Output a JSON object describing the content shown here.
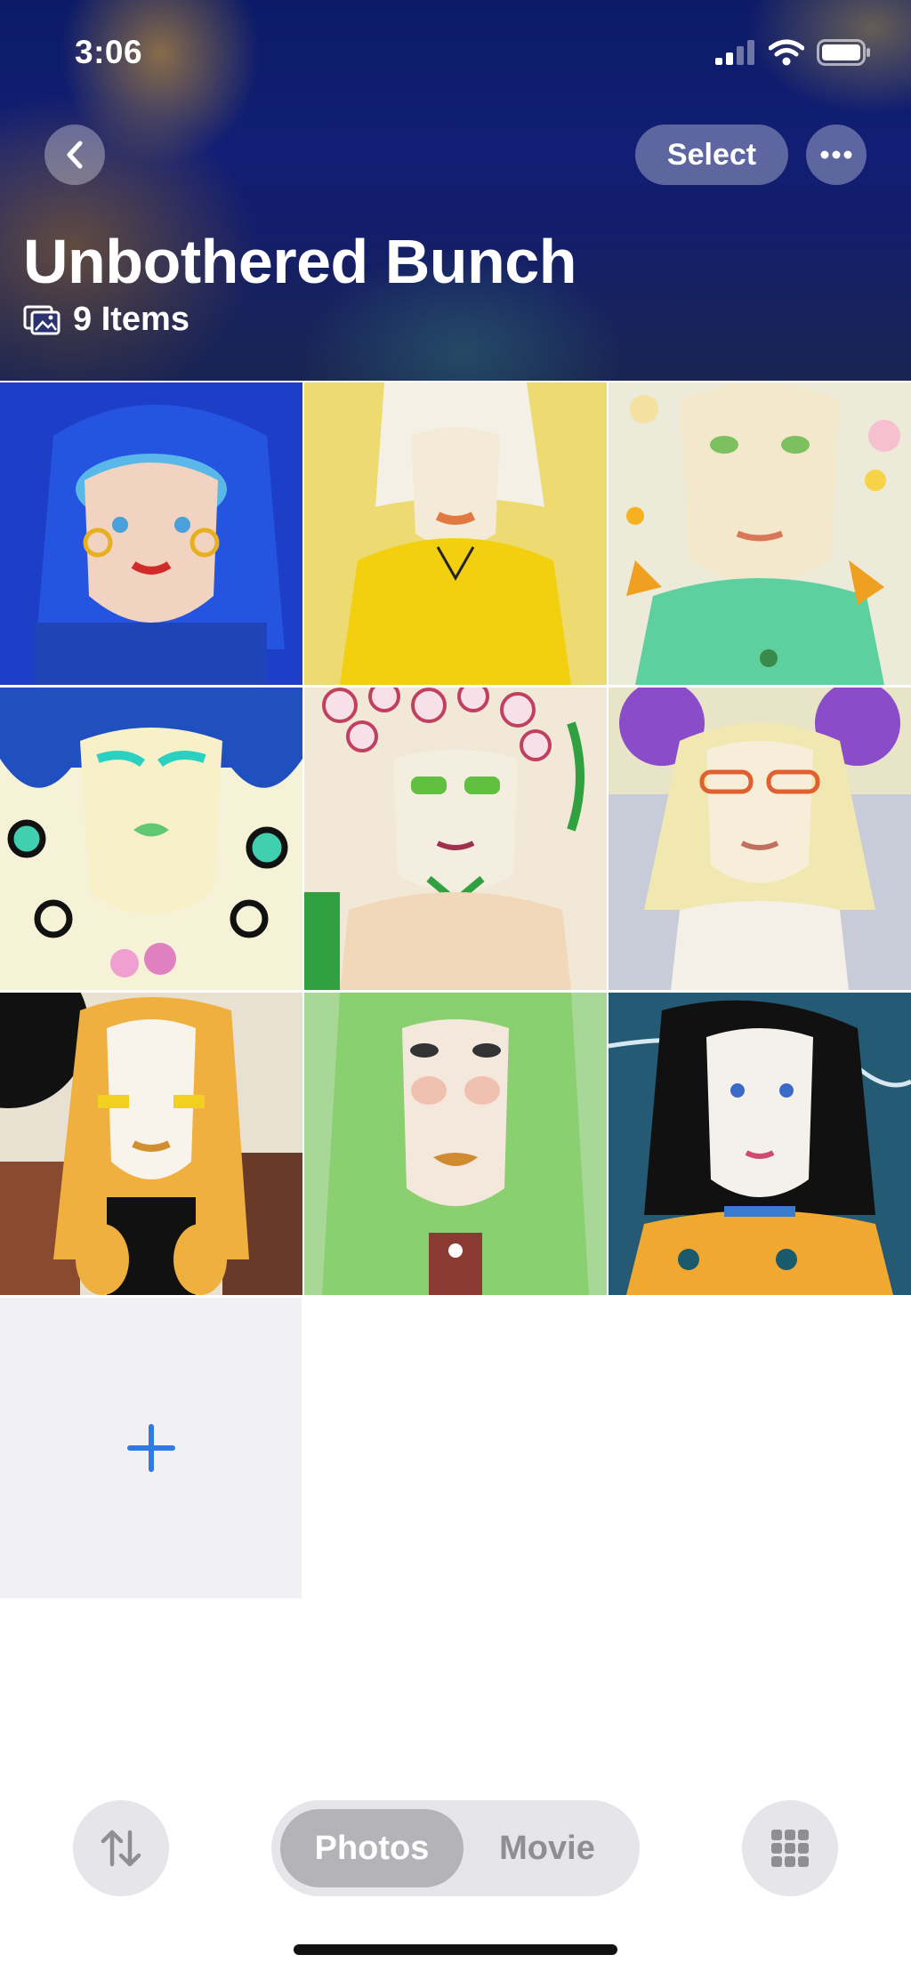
{
  "status_bar": {
    "time": "3:06",
    "icons": [
      "signal-icon",
      "wifi-icon",
      "battery-icon"
    ]
  },
  "header": {
    "back_icon": "chevron-left-icon",
    "select_label": "Select",
    "more_icon": "ellipsis-icon",
    "title": "Unbothered Bunch",
    "items_icon": "photo-stack-icon",
    "items_label": "9 Items"
  },
  "grid": {
    "photos": [
      {
        "name": "portrait-blue-hair"
      },
      {
        "name": "portrait-yellow-sweater"
      },
      {
        "name": "portrait-green-top-flowers"
      },
      {
        "name": "portrait-leopard-print"
      },
      {
        "name": "portrait-floral-headpiece"
      },
      {
        "name": "portrait-purple-buns-glasses"
      },
      {
        "name": "portrait-orange-braids"
      },
      {
        "name": "portrait-green-curly-hair"
      },
      {
        "name": "portrait-dark-hair-blue-background"
      }
    ],
    "add_icon": "plus-icon"
  },
  "toolbar": {
    "sort_icon": "sort-arrows-icon",
    "segments": [
      "Photos",
      "Movie"
    ],
    "selected_segment": "Photos",
    "grid_icon": "grid-icon"
  },
  "colors": {
    "accent": "#2f7ae5",
    "segment_bg": "#e5e5ea",
    "segment_active": "#b4b4b8",
    "add_tile_bg": "#f0f0f5"
  }
}
